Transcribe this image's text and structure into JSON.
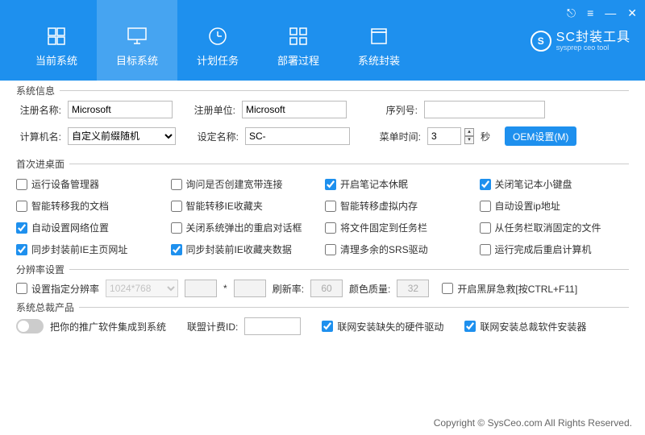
{
  "titlebar": {
    "user_icon": "user",
    "menu_icon": "menu",
    "min_icon": "minimize",
    "close_icon": "close"
  },
  "logo": {
    "main": "SC封装工具",
    "sub": "sysprep ceo tool"
  },
  "tabs": [
    {
      "label": "当前系统",
      "icon": "windows"
    },
    {
      "label": "目标系统",
      "icon": "monitor",
      "active": true
    },
    {
      "label": "计划任务",
      "icon": "clock"
    },
    {
      "label": "部署过程",
      "icon": "grid"
    },
    {
      "label": "系统封装",
      "icon": "package"
    }
  ],
  "sections": {
    "sysinfo": {
      "legend": "系统信息",
      "reg_name_lbl": "注册名称:",
      "reg_name_val": "Microsoft",
      "reg_unit_lbl": "注册单位:",
      "reg_unit_val": "Microsoft",
      "serial_lbl": "序列号:",
      "serial_val": "",
      "comp_name_lbl": "计算机名:",
      "comp_name_select": "自定义前缀随机",
      "set_name_lbl": "设定名称:",
      "set_name_val": "SC-",
      "menu_time_lbl": "菜单时间:",
      "menu_time_val": "3",
      "seconds": "秒",
      "oem_btn": "OEM设置(M)"
    },
    "firstboot": {
      "legend": "首次进桌面",
      "items": [
        {
          "label": "运行设备管理器",
          "checked": false
        },
        {
          "label": "询问是否创建宽带连接",
          "checked": false
        },
        {
          "label": "开启笔记本休眠",
          "checked": true
        },
        {
          "label": "关闭笔记本小键盘",
          "checked": true
        },
        {
          "label": "智能转移我的文档",
          "checked": false
        },
        {
          "label": "智能转移IE收藏夹",
          "checked": false
        },
        {
          "label": "智能转移虚拟内存",
          "checked": false
        },
        {
          "label": "自动设置ip地址",
          "checked": false
        },
        {
          "label": "自动设置网络位置",
          "checked": true
        },
        {
          "label": "关闭系统弹出的重启对话框",
          "checked": false
        },
        {
          "label": "将文件固定到任务栏",
          "checked": false
        },
        {
          "label": "从任务栏取消固定的文件",
          "checked": false
        },
        {
          "label": "同步封装前IE主页网址",
          "checked": true
        },
        {
          "label": "同步封装前IE收藏夹数据",
          "checked": true
        },
        {
          "label": "清理多余的SRS驱动",
          "checked": false
        },
        {
          "label": "运行完成后重启计算机",
          "checked": false
        }
      ]
    },
    "resolution": {
      "legend": "分辨率设置",
      "set_res_lbl": "设置指定分辨率",
      "res_preset": "1024*768",
      "width": "",
      "height": "",
      "refresh_lbl": "刷新率:",
      "refresh_val": "60",
      "colorq_lbl": "颜色质量:",
      "colorq_val": "32",
      "blackscreen_lbl": "开启黑屏急救[按CTRL+F11]"
    },
    "president": {
      "legend": "系统总裁产品",
      "integrate_lbl": "把你的推广软件集成到系统",
      "union_lbl": "联盟计费ID:",
      "union_val": "",
      "net_driver_lbl": "联网安装缺失的硬件驱动",
      "net_driver_checked": true,
      "net_soft_lbl": "联网安装总裁软件安装器",
      "net_soft_checked": true
    }
  },
  "footer": "Copyright © SysCeo.com All Rights Reserved."
}
